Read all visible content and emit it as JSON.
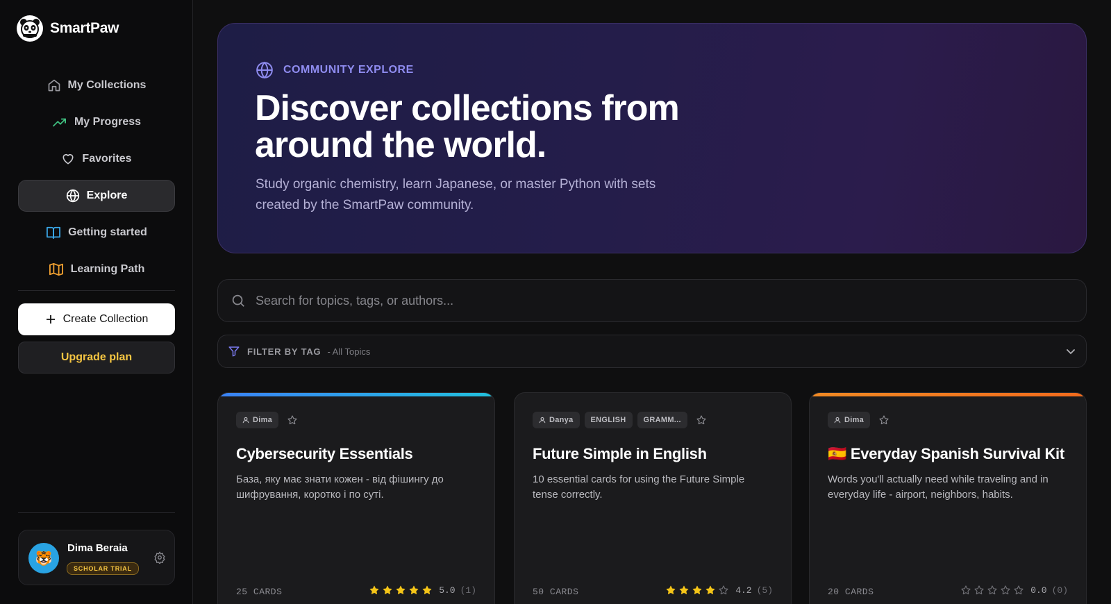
{
  "brand": {
    "name": "SmartPaw",
    "logo_icon": "panda-icon"
  },
  "sidebar": {
    "items": [
      {
        "label": "My Collections",
        "icon": "home-icon",
        "icon_color": "#9a9aa0"
      },
      {
        "label": "My Progress",
        "icon": "trending-up-icon",
        "icon_color": "#3fbf7f"
      },
      {
        "label": "Favorites",
        "icon": "heart-icon",
        "icon_color": "#c9c9ce"
      },
      {
        "label": "Explore",
        "icon": "globe-icon",
        "icon_color": "#ffffff",
        "active": true
      },
      {
        "label": "Getting started",
        "icon": "book-open-icon",
        "icon_color": "#3aa7e8"
      },
      {
        "label": "Learning Path",
        "icon": "map-icon",
        "icon_color": "#f0a030"
      }
    ],
    "create_label": "Create Collection",
    "upgrade_label": "Upgrade plan",
    "user": {
      "name": "Dima Beraia",
      "badge": "SCHOLAR TRIAL",
      "avatar": "🐯"
    }
  },
  "hero": {
    "kicker": "COMMUNITY EXPLORE",
    "title": "Discover collections from around the world.",
    "subtitle": "Study organic chemistry, learn Japanese, or master Python with sets created by the SmartPaw community."
  },
  "search": {
    "placeholder": "Search for topics, tags, or authors..."
  },
  "filter": {
    "label": "FILTER BY TAG",
    "value": "- All Topics"
  },
  "cards": [
    {
      "accent": "#3b82f6",
      "accent2": "#22c1dd",
      "author": "Dima",
      "tags": [],
      "title": "Cybersecurity Essentials",
      "description": "База, яку має знати кожен - від фішингу до шифрування, коротко і по суті.",
      "count": "25 CARDS",
      "rating": 5.0,
      "rating_text": "5.0",
      "rating_count": "(1)"
    },
    {
      "accent": "",
      "author": "Danya",
      "tags": [
        "ENGLISH",
        "GRAMM..."
      ],
      "title": "Future Simple in English",
      "description": "10 essential cards for using the Future Simple tense correctly.",
      "count": "50 CARDS",
      "rating": 4.2,
      "rating_text": "4.2",
      "rating_count": "(5)"
    },
    {
      "accent": "#f08a24",
      "accent2": "#f26b1d",
      "author": "Dima",
      "tags": [],
      "title": "🇪🇸 Everyday Spanish Survival Kit",
      "description": "Words you'll actually need while traveling and in everyday life - airport, neighbors, habits.",
      "count": "20 CARDS",
      "rating": 0.0,
      "rating_text": "0.0",
      "rating_count": "(0)"
    }
  ],
  "colors": {
    "star_filled": "#f5c518",
    "star_empty": "#6f6f75"
  }
}
